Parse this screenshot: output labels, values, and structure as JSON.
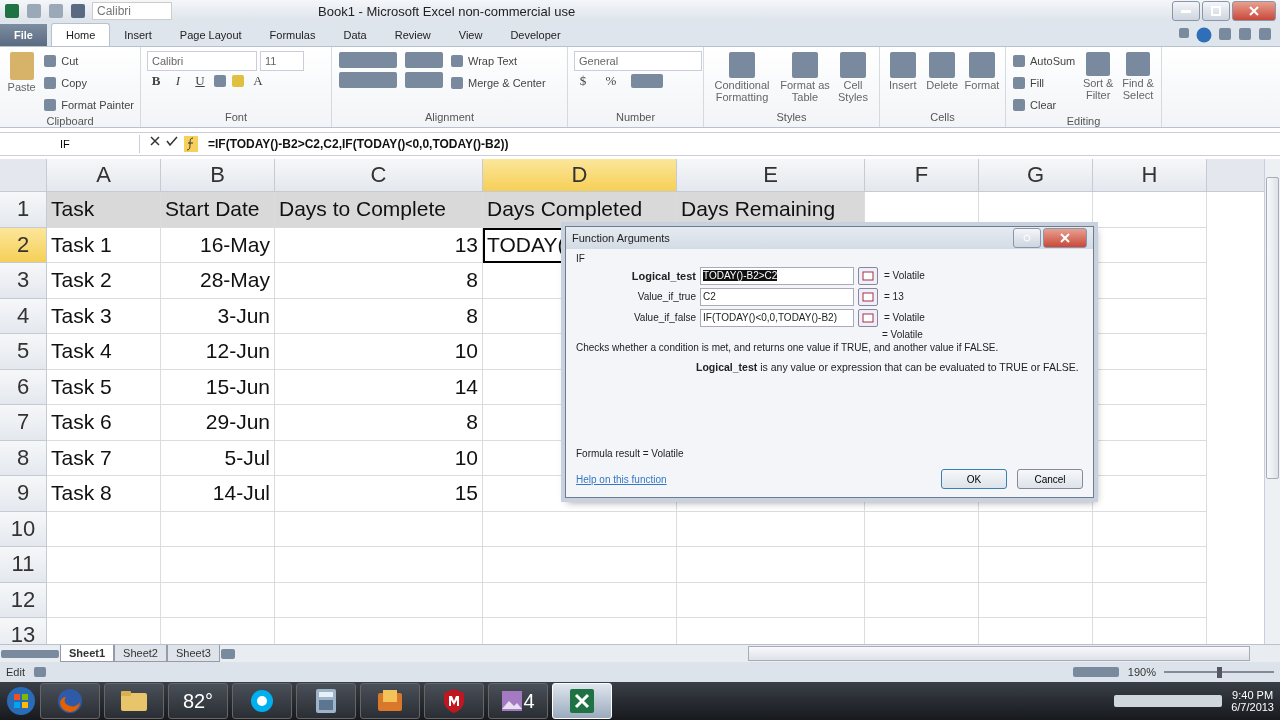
{
  "title_bar": {
    "title": "Book1  -  Microsoft Excel non-commercial use",
    "font_box": "Calibri"
  },
  "ribbon_tabs": [
    {
      "label": "File",
      "kind": "file",
      "selected": false
    },
    {
      "label": "Home",
      "kind": "tab",
      "selected": true
    },
    {
      "label": "Insert",
      "kind": "tab",
      "selected": false
    },
    {
      "label": "Page Layout",
      "kind": "tab",
      "selected": false
    },
    {
      "label": "Formulas",
      "kind": "tab",
      "selected": false
    },
    {
      "label": "Data",
      "kind": "tab",
      "selected": false
    },
    {
      "label": "Review",
      "kind": "tab",
      "selected": false
    },
    {
      "label": "View",
      "kind": "tab",
      "selected": false
    },
    {
      "label": "Developer",
      "kind": "tab",
      "selected": false
    }
  ],
  "clipboard": {
    "label": "Clipboard",
    "paste": "Paste",
    "items": [
      "Cut",
      "Copy",
      "Format Painter"
    ]
  },
  "font": {
    "label": "Font",
    "name": "Calibri",
    "size": "11",
    "styles": [
      "B",
      "I",
      "U"
    ],
    "color_glyph": "A"
  },
  "alignment": {
    "label": "Alignment",
    "wrap": "Wrap Text",
    "merge": "Merge & Center"
  },
  "number": {
    "label": "Number",
    "format": "General",
    "symbols": [
      "$",
      "%"
    ]
  },
  "styles": {
    "label": "Styles",
    "items": [
      "Conditional Formatting",
      "Format as Table",
      "Cell Styles"
    ]
  },
  "cells": {
    "label": "Cells",
    "items": [
      "Insert",
      "Delete",
      "Format"
    ]
  },
  "editing": {
    "label": "Editing",
    "small": [
      "AutoSum",
      "Fill",
      "Clear"
    ],
    "big": [
      "Sort & Filter",
      "Find & Select"
    ]
  },
  "formula_bar": {
    "name_box": "IF",
    "formula": "=IF(TODAY()-B2>C2,C2,IF(TODAY()<0,0,TODAY()-B2))"
  },
  "columns": [
    {
      "label": "A",
      "selected": false
    },
    {
      "label": "B",
      "selected": false
    },
    {
      "label": "C",
      "selected": false
    },
    {
      "label": "D",
      "selected": true
    },
    {
      "label": "E",
      "selected": false
    },
    {
      "label": "F",
      "selected": false
    },
    {
      "label": "G",
      "selected": false
    },
    {
      "label": "H",
      "selected": false
    }
  ],
  "rows": [
    {
      "number": "1",
      "selected": false,
      "cells": [
        {
          "text": "Task",
          "kind": "header"
        },
        {
          "text": "Start Date",
          "kind": "header"
        },
        {
          "text": "Days to Complete",
          "kind": "header"
        },
        {
          "text": "Days Completed",
          "kind": "header"
        },
        {
          "text": "Days Remaining",
          "kind": "header"
        }
      ]
    },
    {
      "number": "2",
      "selected": true,
      "cells": [
        {
          "text": "Task 1",
          "kind": "text"
        },
        {
          "text": "16-May",
          "kind": "number"
        },
        {
          "text": "13",
          "kind": "number"
        },
        {
          "text": "TODAY(",
          "kind": "editing"
        }
      ]
    },
    {
      "number": "3",
      "selected": false,
      "cells": [
        {
          "text": "Task 2",
          "kind": "text"
        },
        {
          "text": "28-May",
          "kind": "number"
        },
        {
          "text": "8",
          "kind": "number"
        }
      ]
    },
    {
      "number": "4",
      "selected": false,
      "cells": [
        {
          "text": "Task 3",
          "kind": "text"
        },
        {
          "text": "3-Jun",
          "kind": "number"
        },
        {
          "text": "8",
          "kind": "number"
        }
      ]
    },
    {
      "number": "5",
      "selected": false,
      "cells": [
        {
          "text": "Task 4",
          "kind": "text"
        },
        {
          "text": "12-Jun",
          "kind": "number"
        },
        {
          "text": "10",
          "kind": "number"
        }
      ]
    },
    {
      "number": "6",
      "selected": false,
      "cells": [
        {
          "text": "Task 5",
          "kind": "text"
        },
        {
          "text": "15-Jun",
          "kind": "number"
        },
        {
          "text": "14",
          "kind": "number"
        }
      ]
    },
    {
      "number": "7",
      "selected": false,
      "cells": [
        {
          "text": "Task 6",
          "kind": "text"
        },
        {
          "text": "29-Jun",
          "kind": "number"
        },
        {
          "text": "8",
          "kind": "number"
        }
      ]
    },
    {
      "number": "8",
      "selected": false,
      "cells": [
        {
          "text": "Task 7",
          "kind": "text"
        },
        {
          "text": "5-Jul",
          "kind": "number"
        },
        {
          "text": "10",
          "kind": "number"
        }
      ]
    },
    {
      "number": "9",
      "selected": false,
      "cells": [
        {
          "text": "Task 8",
          "kind": "text"
        },
        {
          "text": "14-Jul",
          "kind": "number"
        },
        {
          "text": "15",
          "kind": "number"
        }
      ]
    },
    {
      "number": "10",
      "selected": false
    },
    {
      "number": "11",
      "selected": false
    },
    {
      "number": "12",
      "selected": false
    },
    {
      "number": "13",
      "selected": false
    }
  ],
  "dialog": {
    "title": "Function Arguments",
    "function": "IF",
    "args": [
      {
        "label": "Logical_test",
        "value": "TODAY()-B2>C2",
        "result": "= Volatile",
        "active": true
      },
      {
        "label": "Value_if_true",
        "value": "C2",
        "result": "=  13",
        "active": false
      },
      {
        "label": "Value_if_false",
        "value": "IF(TODAY()<0,0,TODAY()-B2)",
        "result": "= Volatile",
        "active": false
      }
    ],
    "total": "= Volatile",
    "description": "Checks whether a condition is met, and returns one value if TRUE, and another value if FALSE.",
    "arg_help": "**Logical_test**  is any value or expression that can be evaluated to TRUE or FALSE.",
    "result": "Formula result =   Volatile",
    "help_link": "Help on this function",
    "buttons": [
      "OK",
      "Cancel"
    ]
  },
  "sheet_tabs": [
    {
      "label": "Sheet1",
      "selected": true
    },
    {
      "label": "Sheet2",
      "selected": false
    },
    {
      "label": "Sheet3",
      "selected": false
    }
  ],
  "status_bar": {
    "mode": "Edit",
    "zoom": "190%",
    "level": 0.5
  },
  "taskbar": {
    "items": [
      {
        "kind": "start"
      },
      {
        "kind": "firefox",
        "active": false
      },
      {
        "kind": "folder",
        "active": false
      },
      {
        "kind": "weather",
        "label": "82°",
        "active": false
      },
      {
        "kind": "skype",
        "active": false
      },
      {
        "kind": "calculator",
        "active": false
      },
      {
        "kind": "app",
        "active": false
      },
      {
        "kind": "shield",
        "active": false
      },
      {
        "kind": "photo",
        "label": "4",
        "active": false
      },
      {
        "kind": "excel",
        "active": true
      }
    ],
    "time": "9:40 PM",
    "date": "6/7/2013"
  }
}
